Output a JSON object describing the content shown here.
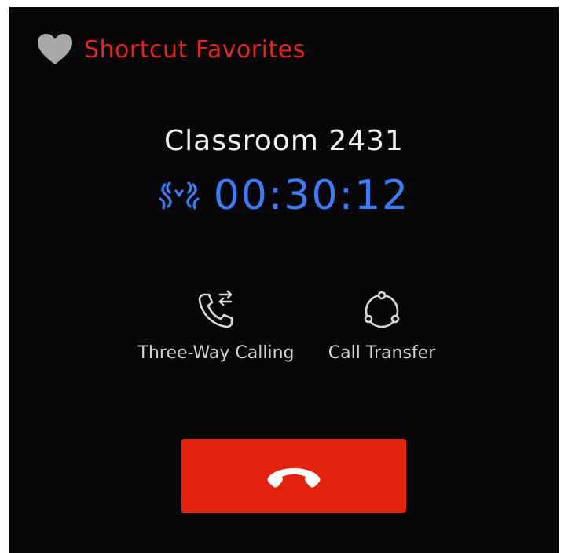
{
  "header": {
    "favorites_label": "Shortcut Favorites",
    "favorites_icon": "heart-icon"
  },
  "call": {
    "name": "Classroom 2431",
    "duration": "00:30:12",
    "status_icon": "intercom-waves-icon"
  },
  "actions": [
    {
      "label": "Three-Way Calling",
      "icon": "phone-transfer-icon"
    },
    {
      "label": "Call Transfer",
      "icon": "transfer-circle-icon"
    }
  ],
  "end_call": {
    "icon": "hang-up-icon"
  },
  "colors": {
    "background": "#070709",
    "accent_red": "#e3230e",
    "favorites_text": "#e0261f",
    "timer_blue": "#3f7bf3",
    "heart_gray": "#a8a8a8"
  }
}
